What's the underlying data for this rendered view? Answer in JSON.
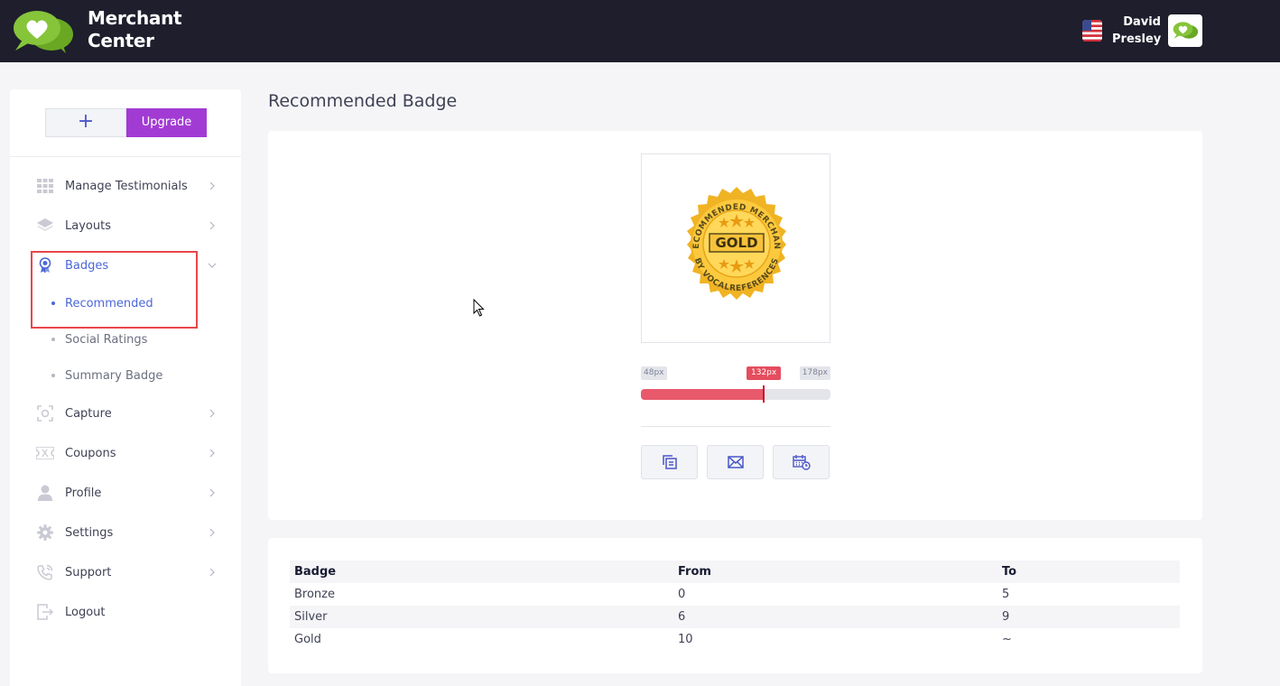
{
  "header": {
    "app_title_line1": "Merchant",
    "app_title_line2": "Center",
    "user_first": "David",
    "user_last": "Presley",
    "colors": {
      "bar": "#1e1e2d",
      "logo_green": "#7dbf2e"
    }
  },
  "sidebar": {
    "add_label": "+",
    "upgrade_label": "Upgrade",
    "items": [
      {
        "label": "Manage Testimonials",
        "icon": "grid-icon"
      },
      {
        "label": "Layouts",
        "icon": "layers-icon"
      },
      {
        "label": "Badges",
        "icon": "award-icon",
        "active": true,
        "expanded": true,
        "children": [
          {
            "label": "Recommended",
            "active": true
          },
          {
            "label": "Social Ratings"
          },
          {
            "label": "Summary Badge"
          }
        ]
      },
      {
        "label": "Capture",
        "icon": "capture-icon"
      },
      {
        "label": "Coupons",
        "icon": "ticket-icon"
      },
      {
        "label": "Profile",
        "icon": "user-icon"
      },
      {
        "label": "Settings",
        "icon": "gear-icon"
      },
      {
        "label": "Support",
        "icon": "phone-icon"
      },
      {
        "label": "Logout",
        "icon": "logout-icon"
      }
    ]
  },
  "main": {
    "title": "Recommended Badge",
    "badge_image": {
      "arc_top": "RECOMMENDED MERCHANT",
      "center": "GOLD",
      "arc_bottom": "BY VOCALREFERENCES"
    },
    "size_slider": {
      "min_label": "48px",
      "max_label": "178px",
      "value_label": "132px",
      "min": 48,
      "max": 178,
      "value": 132
    },
    "actions": [
      {
        "icon": "copy-icon"
      },
      {
        "icon": "mail-icon"
      },
      {
        "icon": "calendar-icon"
      }
    ]
  },
  "levels_table": {
    "headers": [
      "Badge",
      "From",
      "To"
    ],
    "rows": [
      [
        "Bronze",
        "0",
        "5"
      ],
      [
        "Silver",
        "6",
        "9"
      ],
      [
        "Gold",
        "10",
        "~"
      ]
    ]
  }
}
